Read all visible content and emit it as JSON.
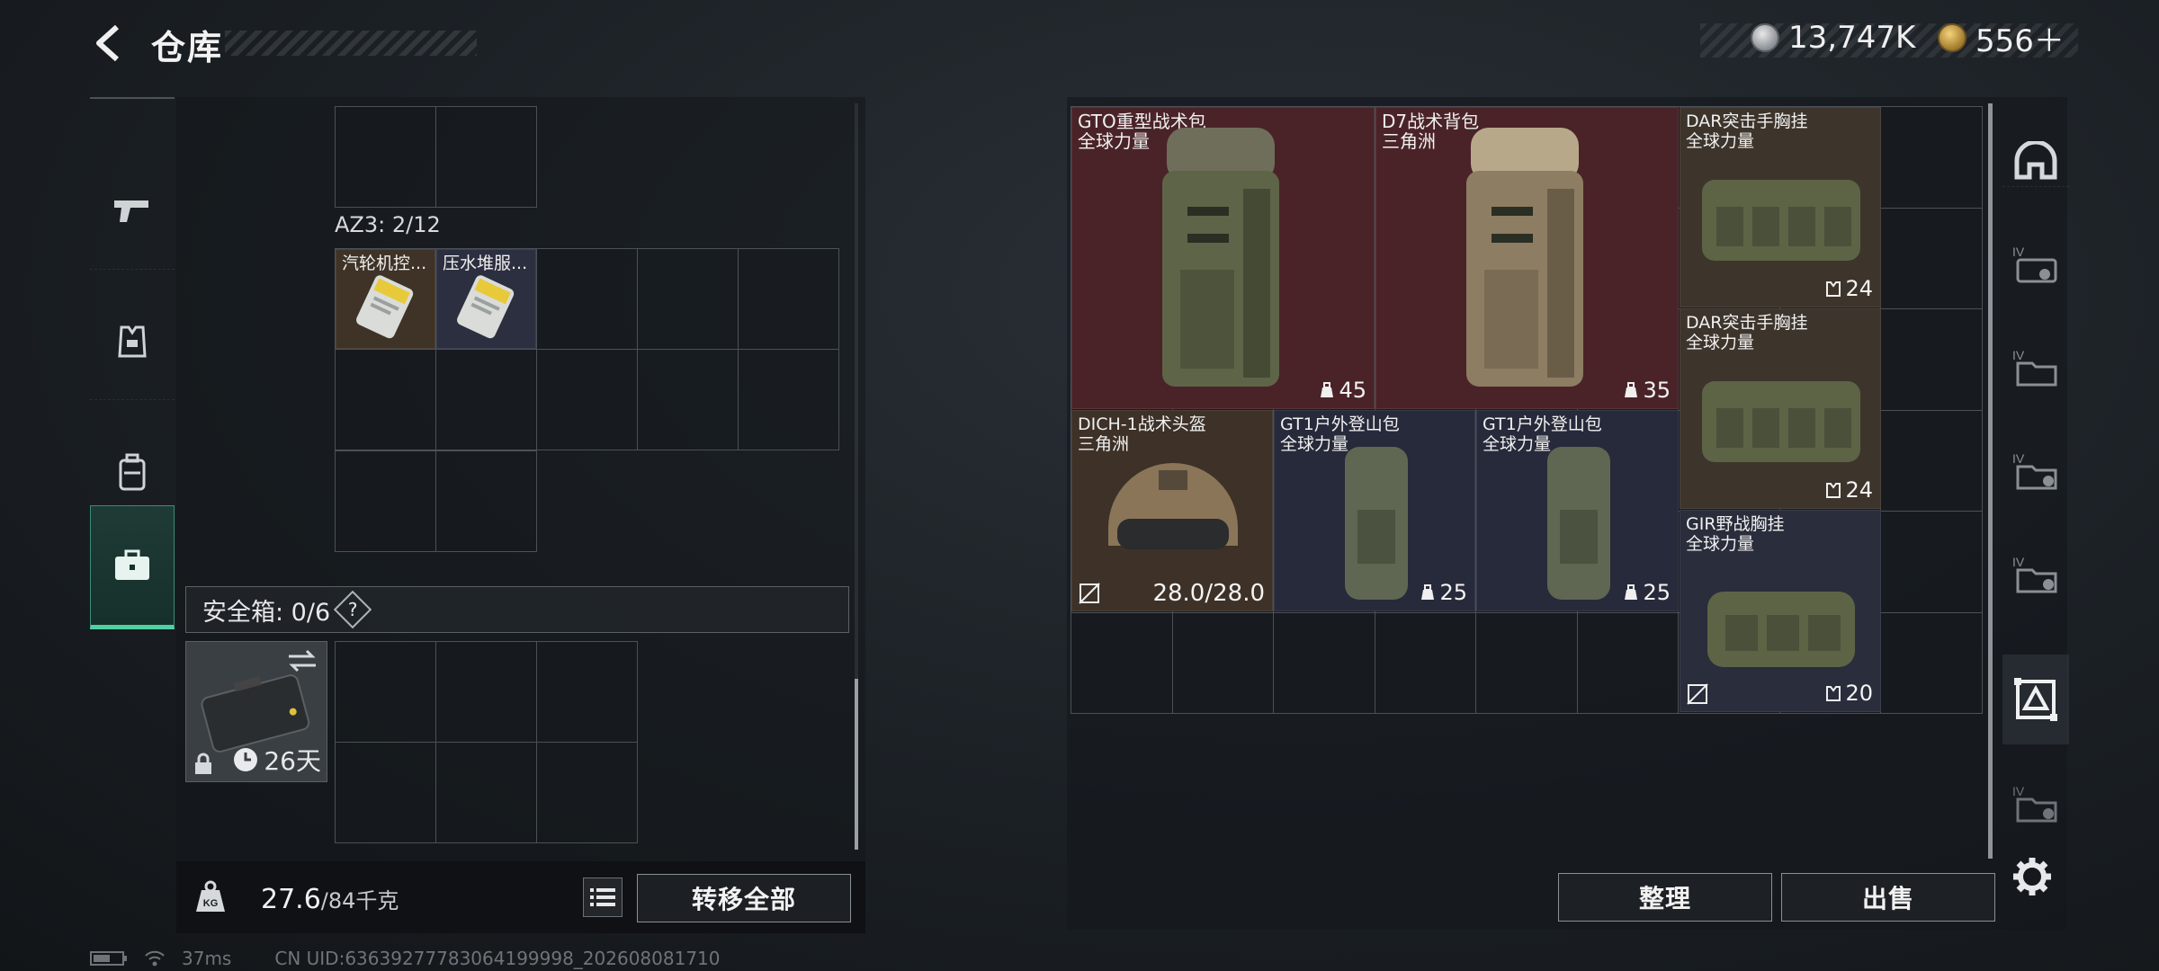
{
  "header": {
    "title": "仓库",
    "currency_silver": "13,747K",
    "currency_gold": "556＋"
  },
  "left_panel": {
    "container_label": "AZ3: 2/12",
    "items": [
      {
        "name": "汽轮机控..."
      },
      {
        "name": "压水堆服..."
      }
    ],
    "safebox": {
      "label": "安全箱: 0/6",
      "help": "?",
      "timer": "26天"
    },
    "weight": {
      "current": "27.6",
      "max": "/84千克"
    },
    "transfer_all": "转移全部"
  },
  "stash": {
    "items": [
      {
        "name": "GTO重型战术包",
        "source": "全球力量",
        "count": "45",
        "tint": "#4a2328"
      },
      {
        "name": "D7战术背包",
        "source": "三角洲",
        "count": "35",
        "tint": "#4a2328"
      },
      {
        "name": "DAR突击手胸挂",
        "source": "全球力量",
        "count": "24",
        "tint": "#3d352c"
      },
      {
        "name": "DAR突击手胸挂",
        "source": "全球力量",
        "count": "24",
        "tint": "#3d352c"
      },
      {
        "name": "DICH-1战术头盔",
        "source": "三角洲",
        "durability": "28.0/28.0",
        "tint": "#3d3128"
      },
      {
        "name": "GT1户外登山包",
        "source": "全球力量",
        "count": "25",
        "tint": "#272a3a"
      },
      {
        "name": "GT1户外登山包",
        "source": "全球力量",
        "count": "25",
        "tint": "#272a3a"
      },
      {
        "name": "GIR野战胸挂",
        "source": "全球力量",
        "count": "20",
        "tint": "#2a2d3b"
      }
    ],
    "sort": "整理",
    "sell": "出售"
  },
  "status_bar": {
    "ping": "37ms",
    "uid": "CN UID:6363927778306419999​8_202608081710"
  }
}
